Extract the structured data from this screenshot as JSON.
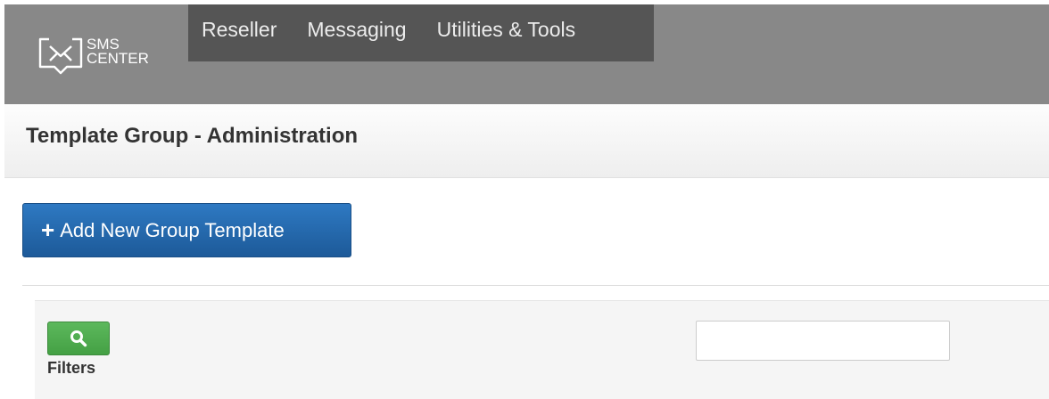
{
  "brand": {
    "line1": "SMS",
    "line2": "CENTER"
  },
  "nav": {
    "items": [
      {
        "label": "Reseller"
      },
      {
        "label": "Messaging"
      },
      {
        "label": "Utilities & Tools"
      }
    ]
  },
  "page": {
    "title": "Template Group - Administration"
  },
  "actions": {
    "add_icon": "plus-icon",
    "add_label": "Add New Group Template"
  },
  "filters": {
    "search_icon": "search-icon",
    "label": "Filters",
    "input_value": "",
    "input_placeholder": ""
  },
  "colors": {
    "navbar": "#888888",
    "menu": "#555555",
    "primary_button": "#2567AA",
    "search_button": "#4CAF50"
  }
}
